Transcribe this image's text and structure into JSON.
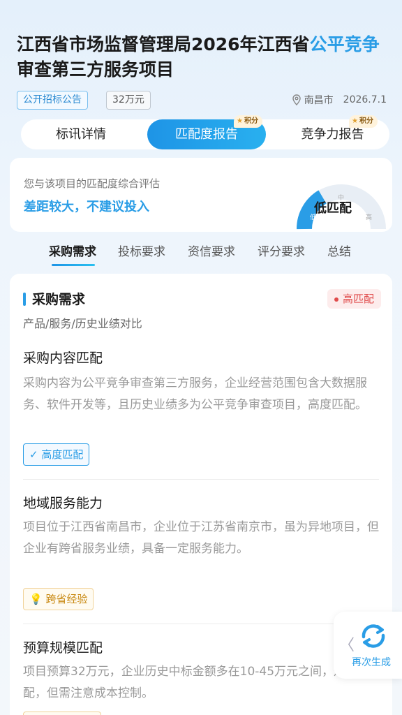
{
  "header": {
    "title_prefix": "江西省市场监督管理局2026年江西省",
    "title_highlight": "公平竞争",
    "title_suffix": "审查第三方服务项目",
    "tag_type": "公开招标公告",
    "tag_amount": "32万元",
    "location": "南昌市",
    "date": "2026.7.1"
  },
  "tabs": [
    {
      "label": "标讯详情"
    },
    {
      "label": "匹配度报告",
      "badge": "积分"
    },
    {
      "label": "竞争力报告",
      "badge": "积分"
    }
  ],
  "summary": {
    "subtitle": "您与该项目的匹配度综合评估",
    "verdict": "差距较大，不建议投入",
    "gauge_low": "低",
    "gauge_mid": "中",
    "gauge_high": "高",
    "gauge_label": "低匹配",
    "gauge_level": 0.33
  },
  "subtabs": [
    "采购需求",
    "投标要求",
    "资信要求",
    "评分要求",
    "总结"
  ],
  "section": {
    "title": "采购需求",
    "badge": "高匹配",
    "desc": "产品/服务/历史业绩对比",
    "items": [
      {
        "title": "采购内容匹配",
        "body": "采购内容为公平竞争审查第三方服务，企业经营范围包含大数据服务、软件开发等，且历史业绩多为公平竞争审查项目，高度匹配。",
        "chip": "高度匹配"
      },
      {
        "title": "地域服务能力",
        "body": "项目位于江西省南昌市，企业位于江苏省南京市，虽为异地项目，但企业有跨省服务业绩，具备一定服务能力。",
        "chip": "跨省经验"
      },
      {
        "title": "预算规模匹配",
        "body": "项目预算32万元，企业历史中标金额多在10-45万元之间，规模匹配，但需注意成本控制。"
      }
    ]
  },
  "float_button": {
    "label": "再次生成"
  },
  "colors": {
    "accent": "#2a9de6",
    "danger": "#e04b4b",
    "warn": "#c98a14"
  }
}
